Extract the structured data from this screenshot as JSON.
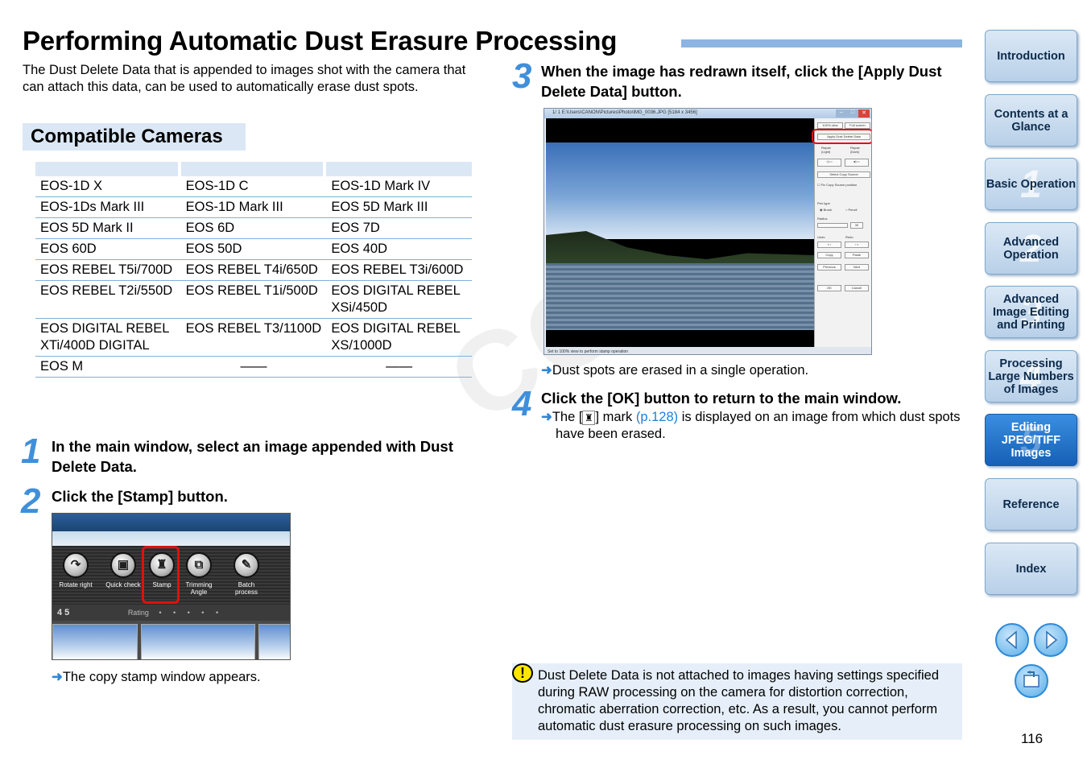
{
  "page": {
    "title": "Performing Automatic Dust Erasure Processing",
    "intro": "The Dust Delete Data that is appended to images shot with the camera that can attach this data, can be used to automatically erase dust spots.",
    "page_number": "116",
    "watermark": "COPY"
  },
  "compatible": {
    "heading": "Compatible Cameras",
    "rows": [
      [
        "EOS-1D X",
        "EOS-1D C",
        "EOS-1D Mark IV"
      ],
      [
        "EOS-1Ds Mark III",
        "EOS-1D Mark III",
        "EOS 5D Mark III"
      ],
      [
        "EOS 5D Mark II",
        "EOS 6D",
        "EOS 7D"
      ],
      [
        "EOS 60D",
        "EOS 50D",
        "EOS 40D"
      ],
      [
        "EOS REBEL T5i/700D",
        "EOS REBEL T4i/650D",
        "EOS REBEL T3i/600D"
      ],
      [
        "EOS REBEL T2i/550D",
        "EOS REBEL T1i/500D",
        "EOS DIGITAL REBEL XSi/450D"
      ],
      [
        "EOS DIGITAL REBEL XTi/400D DIGITAL",
        "EOS REBEL T3/1100D",
        "EOS DIGITAL REBEL XS/1000D"
      ],
      [
        "EOS M",
        "——",
        "——"
      ]
    ]
  },
  "steps": {
    "s1": {
      "num": "1",
      "text": "In the main window, select an image appended with Dust Delete Data."
    },
    "s2": {
      "num": "2",
      "text": "Click the [Stamp] button.",
      "result": "The copy stamp window appears."
    },
    "s3": {
      "num": "3",
      "text": "When the image has redrawn itself, click the [Apply Dust Delete Data] button.",
      "result": "Dust spots are erased in a single operation."
    },
    "s4": {
      "num": "4",
      "text": "Click the [OK] button to return to the main window.",
      "result_pre": "The [",
      "result_mid": "] mark",
      "result_link": "(p.128)",
      "result_post": "is displayed on an image from which dust spots have been erased."
    }
  },
  "shot1": {
    "tools": [
      "Rotate right",
      "Quick check",
      "Stamp",
      "Trimming Angle",
      "Batch process"
    ],
    "rating_num": "4 5",
    "rating_label": "Rating"
  },
  "shot2": {
    "window_title": "1/ 1  E:\\Users\\CANON\\Pictures\\Photo\\IMG_0036.JPG [5184 x 3456]",
    "btn_100": "100% view",
    "btn_full": "Full screen",
    "btn_apply": "Apply Dust Delete Data",
    "repair_light": "Repair (Light)",
    "repair_dark": "Repair (Dark)",
    "select_copy": "Select Copy Source",
    "fix_copy": "Fix Copy Source position",
    "pen_type": "Pen type",
    "brush": "Brush",
    "pencil": "Pencil",
    "radius": "Radius",
    "radius_val": "30",
    "undo": "Undo",
    "redo": "Redo",
    "copy": "Copy",
    "paste": "Paste",
    "previous": "Previous",
    "next": "Next",
    "ok": "OK",
    "cancel": "Cancel",
    "status": "Set to 100% view to perform stamp operation"
  },
  "caution": {
    "text": "Dust Delete Data is not attached to images having settings specified during RAW processing on the camera for distortion correction, chromatic aberration correction, etc. As a result, you cannot perform automatic dust erasure processing on such images."
  },
  "nav": {
    "tabs": [
      {
        "label": "Introduction",
        "num": ""
      },
      {
        "label": "Contents at a Glance",
        "num": ""
      },
      {
        "label": "Basic Operation",
        "num": "1"
      },
      {
        "label": "Advanced Operation",
        "num": "2"
      },
      {
        "label": "Advanced Image Editing and Printing",
        "num": "3"
      },
      {
        "label": "Processing Large Numbers of Images",
        "num": "4"
      },
      {
        "label": "Editing JPEG/TIFF Images",
        "num": "5"
      },
      {
        "label": "Reference",
        "num": ""
      },
      {
        "label": "Index",
        "num": ""
      }
    ]
  },
  "colors": {
    "accent": "#3f8fdb",
    "table_rule": "#7fb0d9",
    "nav_active": "#1660b6",
    "highlight": "#e01010"
  }
}
